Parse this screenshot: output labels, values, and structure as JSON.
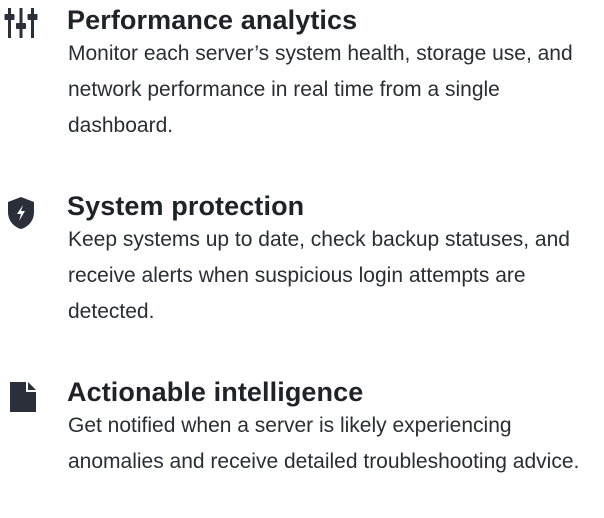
{
  "features": [
    {
      "icon": "sliders-icon",
      "title": "Performance analytics",
      "description": "Monitor each server’s system health, storage use, and network performance in real time from a single dashboard."
    },
    {
      "icon": "shield-bolt-icon",
      "title": "System protection",
      "description": "Keep systems up to date, check backup statuses, and receive alerts when suspicious login attempts are detected."
    },
    {
      "icon": "document-icon",
      "title": "Actionable intelligence",
      "description": "Get notified when a server is likely experiencing anomalies and receive detailed troubleshooting advice."
    }
  ],
  "colors": {
    "text": "#1f2229",
    "icon": "#2b2f3a"
  }
}
